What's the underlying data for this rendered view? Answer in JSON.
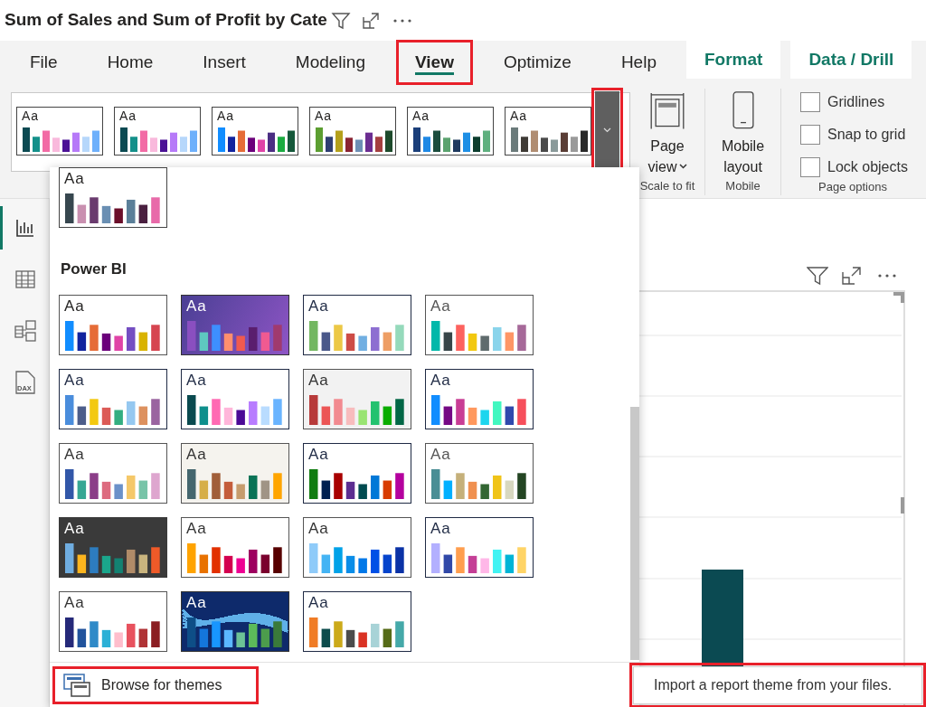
{
  "visual_title": {
    "text": "Sum of Sales and Sum of Profit by Cate"
  },
  "ribbon_tabs": [
    {
      "label": "File",
      "kind": "main",
      "selected": false,
      "highlighted": false
    },
    {
      "label": "Home",
      "kind": "main",
      "selected": false,
      "highlighted": false
    },
    {
      "label": "Insert",
      "kind": "main",
      "selected": false,
      "highlighted": false
    },
    {
      "label": "Modeling",
      "kind": "main",
      "selected": false,
      "highlighted": false
    },
    {
      "label": "View",
      "kind": "main",
      "selected": true,
      "highlighted": true
    },
    {
      "label": "Optimize",
      "kind": "main",
      "selected": false,
      "highlighted": false
    },
    {
      "label": "Help",
      "kind": "main",
      "selected": false,
      "highlighted": false
    },
    {
      "label": "Format",
      "kind": "contextual",
      "selected": false,
      "highlighted": false
    },
    {
      "label": "Data / Drill",
      "kind": "contextual",
      "selected": false,
      "highlighted": false
    }
  ],
  "theme_gallery": {
    "themes": [
      {
        "sample": {
          "label": "Aa",
          "color": "#252423"
        },
        "color": "#ffffff",
        "frame": {
          "color": "#444444"
        },
        "bars": [
          {
            "color": "#0b4a52"
          },
          {
            "color": "#14908a"
          },
          {
            "color": "#f26ba5"
          },
          {
            "color": "#f9b9dc"
          },
          {
            "color": "#4b1296"
          },
          {
            "color": "#b67af8"
          },
          {
            "color": "#b6d7fb"
          },
          {
            "color": "#6eb0fb"
          }
        ]
      },
      {
        "sample": {
          "label": "Aa",
          "color": "#252423"
        },
        "color": "#ffffff",
        "frame": {
          "color": "#444444"
        },
        "bars": [
          {
            "color": "#0b4a52"
          },
          {
            "color": "#14908a"
          },
          {
            "color": "#f26ba5"
          },
          {
            "color": "#f9b9dc"
          },
          {
            "color": "#4b1296"
          },
          {
            "color": "#b67af8"
          },
          {
            "color": "#b6d7fb"
          },
          {
            "color": "#6eb0fb"
          }
        ]
      },
      {
        "sample": {
          "label": "Aa",
          "color": "#252423"
        },
        "color": "#ffffff",
        "frame": {
          "color": "#444444"
        },
        "bars": [
          {
            "color": "#118dff"
          },
          {
            "color": "#12239e"
          },
          {
            "color": "#e66c37"
          },
          {
            "color": "#6b007b"
          },
          {
            "color": "#e044a7"
          },
          {
            "color": "#4b2e83"
          },
          {
            "color": "#1aab40"
          },
          {
            "color": "#15593b"
          }
        ]
      },
      {
        "sample": {
          "label": "Aa",
          "color": "#252423"
        },
        "color": "#ffffff",
        "frame": {
          "color": "#444444"
        },
        "bars": [
          {
            "color": "#5c9e31"
          },
          {
            "color": "#2f3e72"
          },
          {
            "color": "#b4a01b"
          },
          {
            "color": "#8a2332"
          },
          {
            "color": "#6e8fb5"
          },
          {
            "color": "#6b2d91"
          },
          {
            "color": "#a43f3f"
          },
          {
            "color": "#1d4a2b"
          }
        ]
      },
      {
        "sample": {
          "label": "Aa",
          "color": "#252423"
        },
        "color": "#ffffff",
        "frame": {
          "color": "#444444"
        },
        "bars": [
          {
            "color": "#1b3f7a"
          },
          {
            "color": "#1e88e5"
          },
          {
            "color": "#1b4d3e"
          },
          {
            "color": "#5aa26e"
          },
          {
            "color": "#1e3a5f"
          },
          {
            "color": "#1e8fe5"
          },
          {
            "color": "#0b3d2e"
          },
          {
            "color": "#5fb07f"
          }
        ]
      },
      {
        "sample": {
          "label": "Aa",
          "color": "#252423"
        },
        "color": "#ffffff",
        "frame": {
          "color": "#444444"
        },
        "bars": [
          {
            "color": "#6b7b7b"
          },
          {
            "color": "#3f3b36"
          },
          {
            "color": "#b08d72"
          },
          {
            "color": "#4a4a4a"
          },
          {
            "color": "#8a9a9a"
          },
          {
            "color": "#5a3e36"
          },
          {
            "color": "#9a9a9a"
          },
          {
            "color": "#2a2a2a"
          }
        ]
      }
    ],
    "expand_button": {
      "highlighted": true
    }
  },
  "scale_group": {
    "button": "Page view",
    "caption": "Scale to fit"
  },
  "mobile_group": {
    "button": "Mobile layout",
    "caption": "Mobile"
  },
  "page_options": {
    "checkboxes": [
      {
        "label": "Gridlines",
        "checked": false
      },
      {
        "label": "Snap to grid",
        "checked": false
      },
      {
        "label": "Lock objects",
        "checked": false
      }
    ],
    "caption": "Page options"
  },
  "sidebar": {
    "items": [
      {
        "kind": "report",
        "selected": true
      },
      {
        "kind": "table",
        "selected": false
      },
      {
        "kind": "model",
        "selected": false
      },
      {
        "kind": "dax",
        "selected": false,
        "label": "DAX"
      }
    ]
  },
  "theme_menu": {
    "themes_above": [
      {
        "sample": {
          "label": "Aa",
          "color": "#252423"
        },
        "color": "#ffffff",
        "frame": {
          "color": "#444444"
        },
        "bars": [
          {
            "color": "#37474f"
          },
          {
            "color": "#c990b0"
          },
          {
            "color": "#6a3b6e"
          },
          {
            "color": "#6a8fb3"
          },
          {
            "color": "#6b0f2a"
          },
          {
            "color": "#5b7f99"
          },
          {
            "color": "#4a2040"
          },
          {
            "color": "#e86aa9"
          }
        ]
      }
    ],
    "section_title": "Power BI",
    "themes": [
      {
        "kind": "plain",
        "sample": {
          "label": "Aa",
          "color": "#252423"
        },
        "color": "#ffffff",
        "frame": {
          "color": "#555555"
        },
        "bars": [
          {
            "color": "#118dff"
          },
          {
            "color": "#12239e"
          },
          {
            "color": "#e66c37"
          },
          {
            "color": "#6b007b"
          },
          {
            "color": "#e044a7"
          },
          {
            "color": "#744ec2"
          },
          {
            "color": "#d9b300"
          },
          {
            "color": "#d64550"
          }
        ]
      },
      {
        "kind": "gradient",
        "sample": {
          "label": "Aa",
          "color": "#ffffff"
        },
        "color": "#4a3f94",
        "gradient_end": {
          "color": "#8e55c5"
        },
        "frame": {
          "color": "#333333"
        },
        "bars": [
          {
            "color": "#8a4fc0"
          },
          {
            "color": "#5ec8c0"
          },
          {
            "color": "#3d8fff"
          },
          {
            "color": "#ff8f6e"
          },
          {
            "color": "#f05a4f"
          },
          {
            "color": "#5a1e6e"
          },
          {
            "color": "#f05a91"
          },
          {
            "color": "#a03a6e"
          }
        ]
      },
      {
        "kind": "plain",
        "sample": {
          "label": "Aa",
          "color": "#1f2a44"
        },
        "color": "#ffffff",
        "frame": {
          "color": "#1f2a44"
        },
        "bars": [
          {
            "color": "#73b761"
          },
          {
            "color": "#4a588a"
          },
          {
            "color": "#ecc846"
          },
          {
            "color": "#cd4c46"
          },
          {
            "color": "#71afe2"
          },
          {
            "color": "#8d6fd1"
          },
          {
            "color": "#ee9e64"
          },
          {
            "color": "#95dabb"
          }
        ]
      },
      {
        "kind": "plain",
        "sample": {
          "label": "Aa",
          "color": "#555555"
        },
        "color": "#ffffff",
        "frame": {
          "color": "#555555"
        },
        "bars": [
          {
            "color": "#01b8aa"
          },
          {
            "color": "#374649"
          },
          {
            "color": "#fd625e"
          },
          {
            "color": "#f2c80f"
          },
          {
            "color": "#5f6b6d"
          },
          {
            "color": "#8ad4eb"
          },
          {
            "color": "#fe9666"
          },
          {
            "color": "#a66999"
          }
        ]
      },
      {
        "kind": "plain",
        "sample": {
          "label": "Aa",
          "color": "#1f2a44"
        },
        "color": "#ffffff",
        "frame": {
          "color": "#1f2a44"
        },
        "bars": [
          {
            "color": "#4a8ddc"
          },
          {
            "color": "#4c5d8a"
          },
          {
            "color": "#f3c911"
          },
          {
            "color": "#dc5b57"
          },
          {
            "color": "#33ae81"
          },
          {
            "color": "#95c8f0"
          },
          {
            "color": "#dd915f"
          },
          {
            "color": "#9a64a0"
          }
        ]
      },
      {
        "kind": "plain",
        "sample": {
          "label": "Aa",
          "color": "#1f2a44"
        },
        "color": "#ffffff",
        "frame": {
          "color": "#1f2a44"
        },
        "bars": [
          {
            "color": "#0a4a4f"
          },
          {
            "color": "#0e8f8c"
          },
          {
            "color": "#ff6ab3"
          },
          {
            "color": "#ffb6da"
          },
          {
            "color": "#4b0a96"
          },
          {
            "color": "#b87cff"
          },
          {
            "color": "#b9dcff"
          },
          {
            "color": "#6ab4ff"
          }
        ]
      },
      {
        "kind": "plain",
        "sample": {
          "label": "Aa",
          "color": "#333333"
        },
        "color": "#f2f2f2",
        "frame": {
          "color": "#555555"
        },
        "bars": [
          {
            "color": "#b73a3a"
          },
          {
            "color": "#ec5656"
          },
          {
            "color": "#f28a90"
          },
          {
            "color": "#f8bcbd"
          },
          {
            "color": "#99e472"
          },
          {
            "color": "#23c26f"
          },
          {
            "color": "#0aac00"
          },
          {
            "color": "#026645"
          }
        ]
      },
      {
        "kind": "plain",
        "sample": {
          "label": "Aa",
          "color": "#1f2a44"
        },
        "color": "#ffffff",
        "frame": {
          "color": "#1f2a44"
        },
        "bars": [
          {
            "color": "#118dff"
          },
          {
            "color": "#750985"
          },
          {
            "color": "#c83d95"
          },
          {
            "color": "#ff985e"
          },
          {
            "color": "#1dd5ee"
          },
          {
            "color": "#42f7c0"
          },
          {
            "color": "#3049ad"
          },
          {
            "color": "#f64f5c"
          }
        ]
      },
      {
        "kind": "plain",
        "sample": {
          "label": "Aa",
          "color": "#333333"
        },
        "color": "#ffffff",
        "frame": {
          "color": "#555555"
        },
        "bars": [
          {
            "color": "#3257a8"
          },
          {
            "color": "#37a794"
          },
          {
            "color": "#8b3d88"
          },
          {
            "color": "#dd6b7f"
          },
          {
            "color": "#6b91c9"
          },
          {
            "color": "#f5c869"
          },
          {
            "color": "#77c4a8"
          },
          {
            "color": "#dea6cf"
          }
        ]
      },
      {
        "kind": "plain",
        "sample": {
          "label": "Aa",
          "color": "#333333"
        },
        "color": "#f5f3ee",
        "frame": {
          "color": "#555555"
        },
        "bars": [
          {
            "color": "#44666e"
          },
          {
            "color": "#d6ae48"
          },
          {
            "color": "#a15f3a"
          },
          {
            "color": "#c45d3b"
          },
          {
            "color": "#c69c6d"
          },
          {
            "color": "#0a7356"
          },
          {
            "color": "#a09486"
          },
          {
            "color": "#ffa500"
          }
        ]
      },
      {
        "kind": "plain",
        "sample": {
          "label": "Aa",
          "color": "#1f2a44"
        },
        "color": "#ffffff",
        "frame": {
          "color": "#1f2a44"
        },
        "bars": [
          {
            "color": "#107c10"
          },
          {
            "color": "#002050"
          },
          {
            "color": "#a80000"
          },
          {
            "color": "#5c2d91"
          },
          {
            "color": "#004b50"
          },
          {
            "color": "#0078d7"
          },
          {
            "color": "#d83b01"
          },
          {
            "color": "#b4009e"
          }
        ]
      },
      {
        "kind": "plain",
        "sample": {
          "label": "Aa",
          "color": "#555555"
        },
        "color": "#ffffff",
        "frame": {
          "color": "#555555"
        },
        "bars": [
          {
            "color": "#4a8e95"
          },
          {
            "color": "#00b0ff"
          },
          {
            "color": "#c5b07a"
          },
          {
            "color": "#f09050"
          },
          {
            "color": "#336633"
          },
          {
            "color": "#f0c419"
          },
          {
            "color": "#d8d8c0"
          },
          {
            "color": "#244523"
          }
        ]
      },
      {
        "kind": "plain",
        "sample": {
          "label": "Aa",
          "color": "#ffffff"
        },
        "color": "#3a3a3a",
        "frame": {
          "color": "#3a3a3a"
        },
        "bars": [
          {
            "color": "#6fade0"
          },
          {
            "color": "#fdb51e"
          },
          {
            "color": "#2d7cbf"
          },
          {
            "color": "#1aa68c"
          },
          {
            "color": "#138272"
          },
          {
            "color": "#b08b68"
          },
          {
            "color": "#c9b47e"
          },
          {
            "color": "#ef5a28"
          }
        ]
      },
      {
        "kind": "plain",
        "sample": {
          "label": "Aa",
          "color": "#333333"
        },
        "color": "#ffffff",
        "frame": {
          "color": "#555555"
        },
        "bars": [
          {
            "color": "#ffa300"
          },
          {
            "color": "#e87200"
          },
          {
            "color": "#e23000"
          },
          {
            "color": "#d3004f"
          },
          {
            "color": "#ee0092"
          },
          {
            "color": "#9d005f"
          },
          {
            "color": "#7a002e"
          },
          {
            "color": "#570000"
          }
        ]
      },
      {
        "kind": "plain",
        "sample": {
          "label": "Aa",
          "color": "#333333"
        },
        "color": "#ffffff",
        "frame": {
          "color": "#555555"
        },
        "bars": [
          {
            "color": "#8fcbf9"
          },
          {
            "color": "#44b4f4"
          },
          {
            "color": "#00a2e8"
          },
          {
            "color": "#0a8de8"
          },
          {
            "color": "#0078e8"
          },
          {
            "color": "#0050e6"
          },
          {
            "color": "#0544cc"
          },
          {
            "color": "#0a32a6"
          }
        ]
      },
      {
        "kind": "plain",
        "sample": {
          "label": "Aa",
          "color": "#1f2a44"
        },
        "color": "#ffffff",
        "frame": {
          "color": "#1f2a44"
        },
        "bars": [
          {
            "color": "#b3b0ff"
          },
          {
            "color": "#3048a8"
          },
          {
            "color": "#ff9e4e"
          },
          {
            "color": "#c43f96"
          },
          {
            "color": "#ffb7e8"
          },
          {
            "color": "#41f3f3"
          },
          {
            "color": "#00b4d6"
          },
          {
            "color": "#ffd466"
          }
        ]
      },
      {
        "kind": "plain",
        "sample": {
          "label": "Aa",
          "color": "#333333"
        },
        "color": "#ffffff",
        "frame": {
          "color": "#555555"
        },
        "bars": [
          {
            "color": "#252979"
          },
          {
            "color": "#21539c"
          },
          {
            "color": "#2f8ac8"
          },
          {
            "color": "#2cb0d6"
          },
          {
            "color": "#ffbecc"
          },
          {
            "color": "#e8525e"
          },
          {
            "color": "#b03336"
          },
          {
            "color": "#8b1e22"
          }
        ]
      },
      {
        "kind": "wave",
        "sample": {
          "label": "Aa",
          "color": "#ffffff"
        },
        "color": "#0e2a6b",
        "wave": {
          "color": "#5fb0e8"
        },
        "frame": {
          "color": "#333333"
        },
        "bars": [
          {
            "color": "#0e4e87"
          },
          {
            "color": "#1476dc"
          },
          {
            "color": "#1896ff"
          },
          {
            "color": "#5bb8ff"
          },
          {
            "color": "#6cc296"
          },
          {
            "color": "#5cbb5a"
          },
          {
            "color": "#4c9c4c"
          },
          {
            "color": "#3a7a3a"
          }
        ]
      },
      {
        "kind": "plain",
        "sample": {
          "label": "Aa",
          "color": "#1f2a44"
        },
        "color": "#ffffff",
        "frame": {
          "color": "#1f2a44"
        },
        "bars": [
          {
            "color": "#f07c26"
          },
          {
            "color": "#0d4d4d"
          },
          {
            "color": "#ccaa1a"
          },
          {
            "color": "#4c4c4c"
          },
          {
            "color": "#da3324"
          },
          {
            "color": "#a8d3d7"
          },
          {
            "color": "#566b17"
          },
          {
            "color": "#45a9a9"
          }
        ]
      }
    ],
    "footer": {
      "label": "Browse for themes",
      "highlighted": true
    }
  },
  "tooltip": {
    "text": "Import a report theme from your files.",
    "highlighted": true
  }
}
